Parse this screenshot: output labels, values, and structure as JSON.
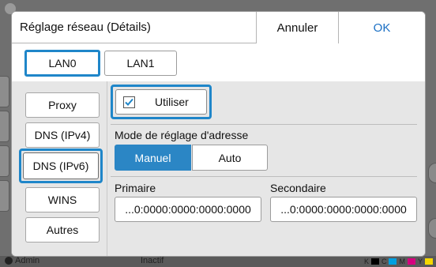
{
  "dialog": {
    "title": "Réglage réseau (Détails)",
    "cancel_label": "Annuler",
    "ok_label": "OK"
  },
  "tabs": [
    {
      "label": "LAN0",
      "active": true
    },
    {
      "label": "LAN1",
      "active": false
    }
  ],
  "sidebar": {
    "items": [
      {
        "label": "Proxy",
        "selected": false
      },
      {
        "label": "DNS (IPv4)",
        "selected": false
      },
      {
        "label": "DNS (IPv6)",
        "selected": true
      },
      {
        "label": "WINS",
        "selected": false
      },
      {
        "label": "Autres",
        "selected": false
      }
    ]
  },
  "settings": {
    "use_label": "Utiliser",
    "use_checked": true,
    "mode_label": "Mode de réglage d'adresse",
    "mode_options": [
      "Manuel",
      "Auto"
    ],
    "mode_selected": "Manuel",
    "primary_label": "Primaire",
    "primary_value": "...0:0000:0000:0000:0000",
    "secondary_label": "Secondaire",
    "secondary_value": "...0:0000:0000:0000:0000"
  },
  "status_bar": {
    "user": "Admin",
    "state": "Inactif",
    "ink_letters": [
      "K",
      "C",
      "M",
      "Y"
    ]
  },
  "colors": {
    "accent": "#1f86c9",
    "selected_segment": "#2b86c5",
    "ok_text": "#1a6fc4",
    "ink_k": "#000000",
    "ink_c": "#00a0e0",
    "ink_m": "#d6007e",
    "ink_y": "#f5d800"
  }
}
